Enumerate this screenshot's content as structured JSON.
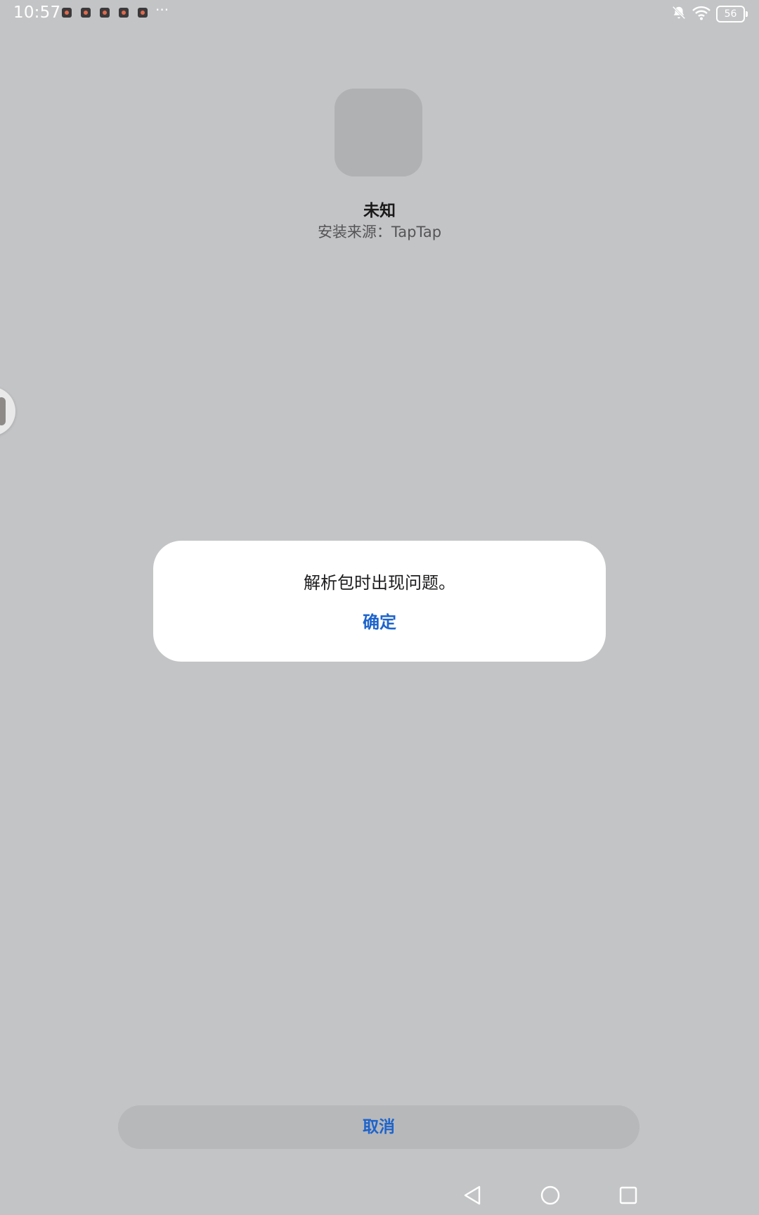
{
  "status_bar": {
    "time": "10:57",
    "notification_icons": [
      "app-notification-icon",
      "app-notification-icon",
      "app-notification-icon",
      "app-notification-icon",
      "app-notification-icon"
    ],
    "more_indicator": "···",
    "battery_level": "56"
  },
  "app": {
    "name": "未知",
    "install_source": "安装来源：TapTap"
  },
  "dialog": {
    "message": "解析包时出现问题。",
    "confirm_label": "确定"
  },
  "footer": {
    "cancel_label": "取消"
  },
  "colors": {
    "background": "#c3c4c6",
    "accent": "#1d64cc",
    "dialog_bg": "#ffffff"
  },
  "icons": {
    "mute": "bell-off-icon",
    "wifi": "wifi-icon",
    "battery": "battery-icon",
    "nav_back": "back-triangle-icon",
    "nav_home": "home-circle-icon",
    "nav_recent": "recent-square-icon"
  }
}
